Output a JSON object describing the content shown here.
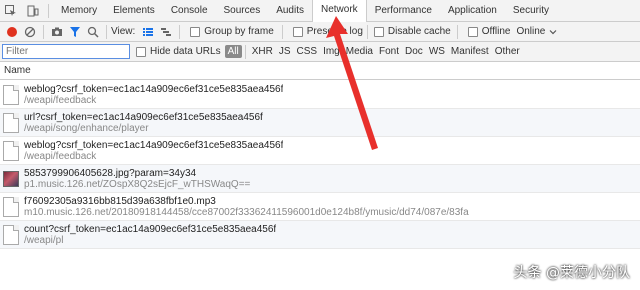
{
  "tabs": {
    "items": [
      "Memory",
      "Elements",
      "Console",
      "Sources",
      "Audits",
      "Network",
      "Performance",
      "Application",
      "Security"
    ],
    "active_index": 5
  },
  "toolbar": {
    "view_label": "View:",
    "group_by_frame": "Group by frame",
    "preserve_log": "Preserve log",
    "disable_cache": "Disable cache",
    "offline": "Offline",
    "throttle": "Online"
  },
  "filterbar": {
    "placeholder": "Filter",
    "hide_data_urls": "Hide data URLs",
    "types": [
      "All",
      "XHR",
      "JS",
      "CSS",
      "Img",
      "Media",
      "Font",
      "Doc",
      "WS",
      "Manifest",
      "Other"
    ],
    "active_type": "All"
  },
  "columns": {
    "name": "Name"
  },
  "requests": [
    {
      "name": "weblog?csrf_token=ec1ac14a909ec6ef31ce5e835aea456f",
      "path": "/weapi/feedback",
      "icon": "file-icon"
    },
    {
      "name": "url?csrf_token=ec1ac14a909ec6ef31ce5e835aea456f",
      "path": "/weapi/song/enhance/player",
      "icon": "file-icon"
    },
    {
      "name": "weblog?csrf_token=ec1ac14a909ec6ef31ce5e835aea456f",
      "path": "/weapi/feedback",
      "icon": "file-icon"
    },
    {
      "name": "5853799906405628.jpg?param=34y34",
      "path": "p1.music.126.net/ZOspX8Q2sEjcF_wTHSWaqQ==",
      "icon": "image-thumbnail"
    },
    {
      "name": "f76092305a9316bb815d39a638fbf1e0.mp3",
      "path": "m10.music.126.net/20180918144458/cce87002f33362411596001d0e124b8f/ymusic/dd74/087e/83fa",
      "icon": "file-icon"
    },
    {
      "name": "count?csrf_token=ec1ac14a909ec6ef31ce5e835aea456f",
      "path": "/weapi/pl",
      "icon": "file-icon"
    }
  ],
  "watermark": "头条 @莱德小分队",
  "colors": {
    "accent_blue": "#1a73e8",
    "record_red": "#e0321f",
    "arrow_red": "#e8302c"
  }
}
